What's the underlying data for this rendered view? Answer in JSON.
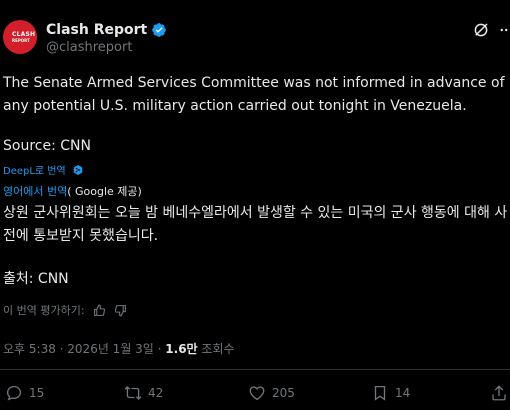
{
  "author": {
    "name": "Clash Report",
    "handle": "@clashreport",
    "avatar_text_line1": "CLASH",
    "avatar_text_line2": "REPORT",
    "avatar_color": "#d21f2b",
    "verified_color": "#1d9bf0"
  },
  "tweet": {
    "text": "The Senate Armed Services Committee was not informed in advance of any potential U.S. military action carried out tonight in Venezuela.",
    "source": "Source: CNN"
  },
  "deepl": {
    "label": "DeepL로 번역",
    "icon": "deepl-icon"
  },
  "google": {
    "link_label": "영어에서 번역",
    "suffix": "( Google 제공)"
  },
  "translation": {
    "text": "상원 군사위원회는 오늘 밤 베네수엘라에서 발생할 수 있는 미국의 군사 행동에 대해 사전에 통보받지 못했습니다.",
    "source": "출처: CNN"
  },
  "rate": {
    "label": "이 번역 평가하기:",
    "icons": [
      "thumbs-up-icon",
      "thumbs-down-icon"
    ]
  },
  "meta": {
    "time_date": "오후 5:38 · 2026년 1월 3일 · ",
    "views_count": "1.6만",
    "views_label": " 조회수"
  },
  "actions": {
    "reply_count": "15",
    "repost_count": "42",
    "like_count": "205",
    "bookmark_count": "14"
  },
  "header_icons": [
    "grok-icon",
    "more-icon"
  ],
  "colors": {
    "background": "#000000",
    "text": "#e7e9ea",
    "secondary": "#71767b",
    "link": "#1d9bf0",
    "divider": "#2f3336"
  }
}
